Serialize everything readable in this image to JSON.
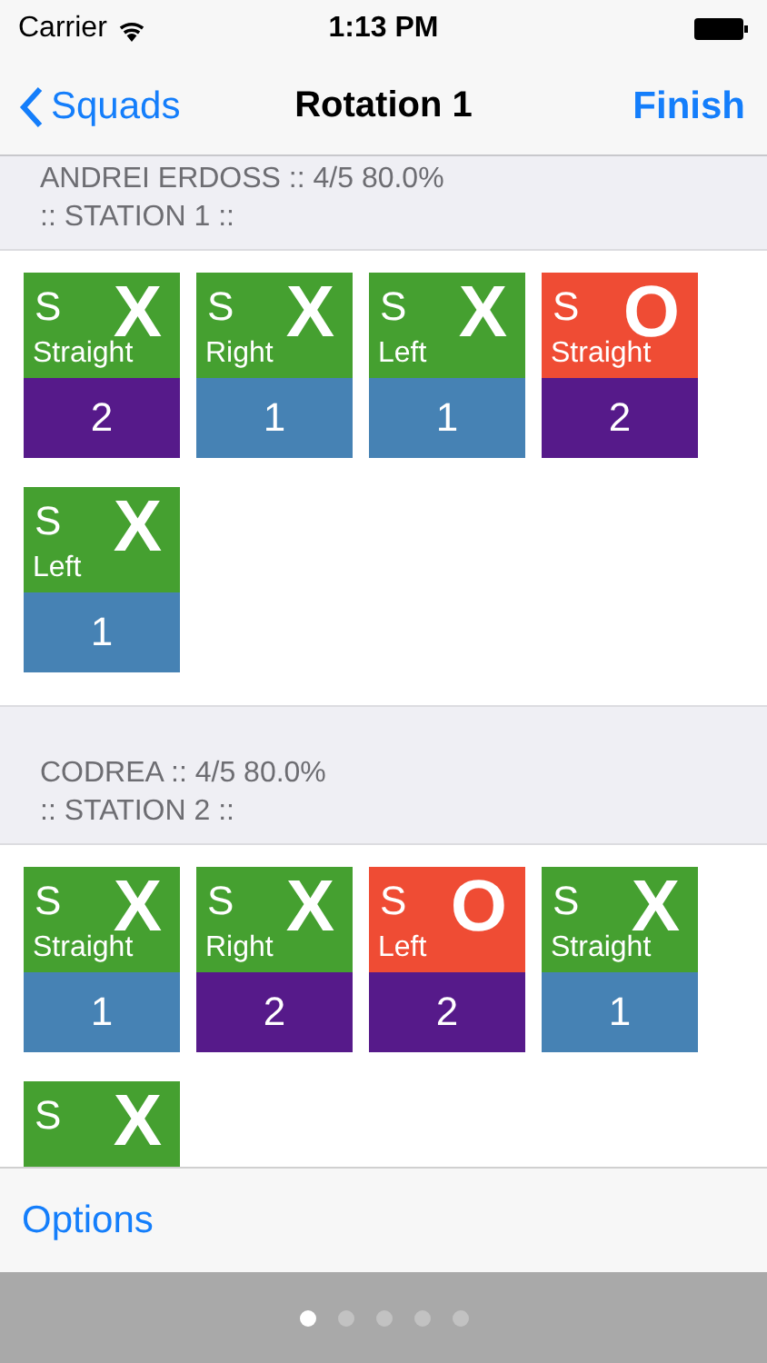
{
  "status_bar": {
    "carrier": "Carrier",
    "time": "1:13 PM"
  },
  "nav": {
    "back": "Squads",
    "title": "Rotation 1",
    "action": "Finish"
  },
  "sections": [
    {
      "header": "ANDREI ERDOSS :: 4/5 80.0%",
      "station": ":: STATION 1 ::",
      "tiles": [
        {
          "kind": "hit",
          "letter": "S",
          "mark": "X",
          "direction": "Straight",
          "count": "2",
          "color": "#561a8a"
        },
        {
          "kind": "hit",
          "letter": "S",
          "mark": "X",
          "direction": "Right",
          "count": "1",
          "color": "#4682b4"
        },
        {
          "kind": "hit",
          "letter": "S",
          "mark": "X",
          "direction": "Left",
          "count": "1",
          "color": "#4682b4"
        },
        {
          "kind": "miss",
          "letter": "S",
          "mark": "O",
          "direction": "Straight",
          "count": "2",
          "color": "#561a8a"
        },
        {
          "kind": "hit",
          "letter": "S",
          "mark": "X",
          "direction": "Left",
          "count": "1",
          "color": "#4682b4"
        }
      ]
    },
    {
      "header": "CODREA :: 4/5 80.0%",
      "station": ":: STATION 2 ::",
      "tiles": [
        {
          "kind": "hit",
          "letter": "S",
          "mark": "X",
          "direction": "Straight",
          "count": "1",
          "color": "#4682b4"
        },
        {
          "kind": "hit",
          "letter": "S",
          "mark": "X",
          "direction": "Right",
          "count": "2",
          "color": "#561a8a"
        },
        {
          "kind": "miss",
          "letter": "S",
          "mark": "O",
          "direction": "Left",
          "count": "2",
          "color": "#561a8a"
        },
        {
          "kind": "hit",
          "letter": "S",
          "mark": "X",
          "direction": "Straight",
          "count": "1",
          "color": "#4682b4"
        },
        {
          "kind": "hit",
          "letter": "S",
          "mark": "X"
        }
      ]
    }
  ],
  "toolbar": {
    "options": "Options"
  },
  "pages": [
    {
      "selected": true
    },
    {
      "selected": false
    },
    {
      "selected": false
    },
    {
      "selected": false
    },
    {
      "selected": false
    }
  ]
}
